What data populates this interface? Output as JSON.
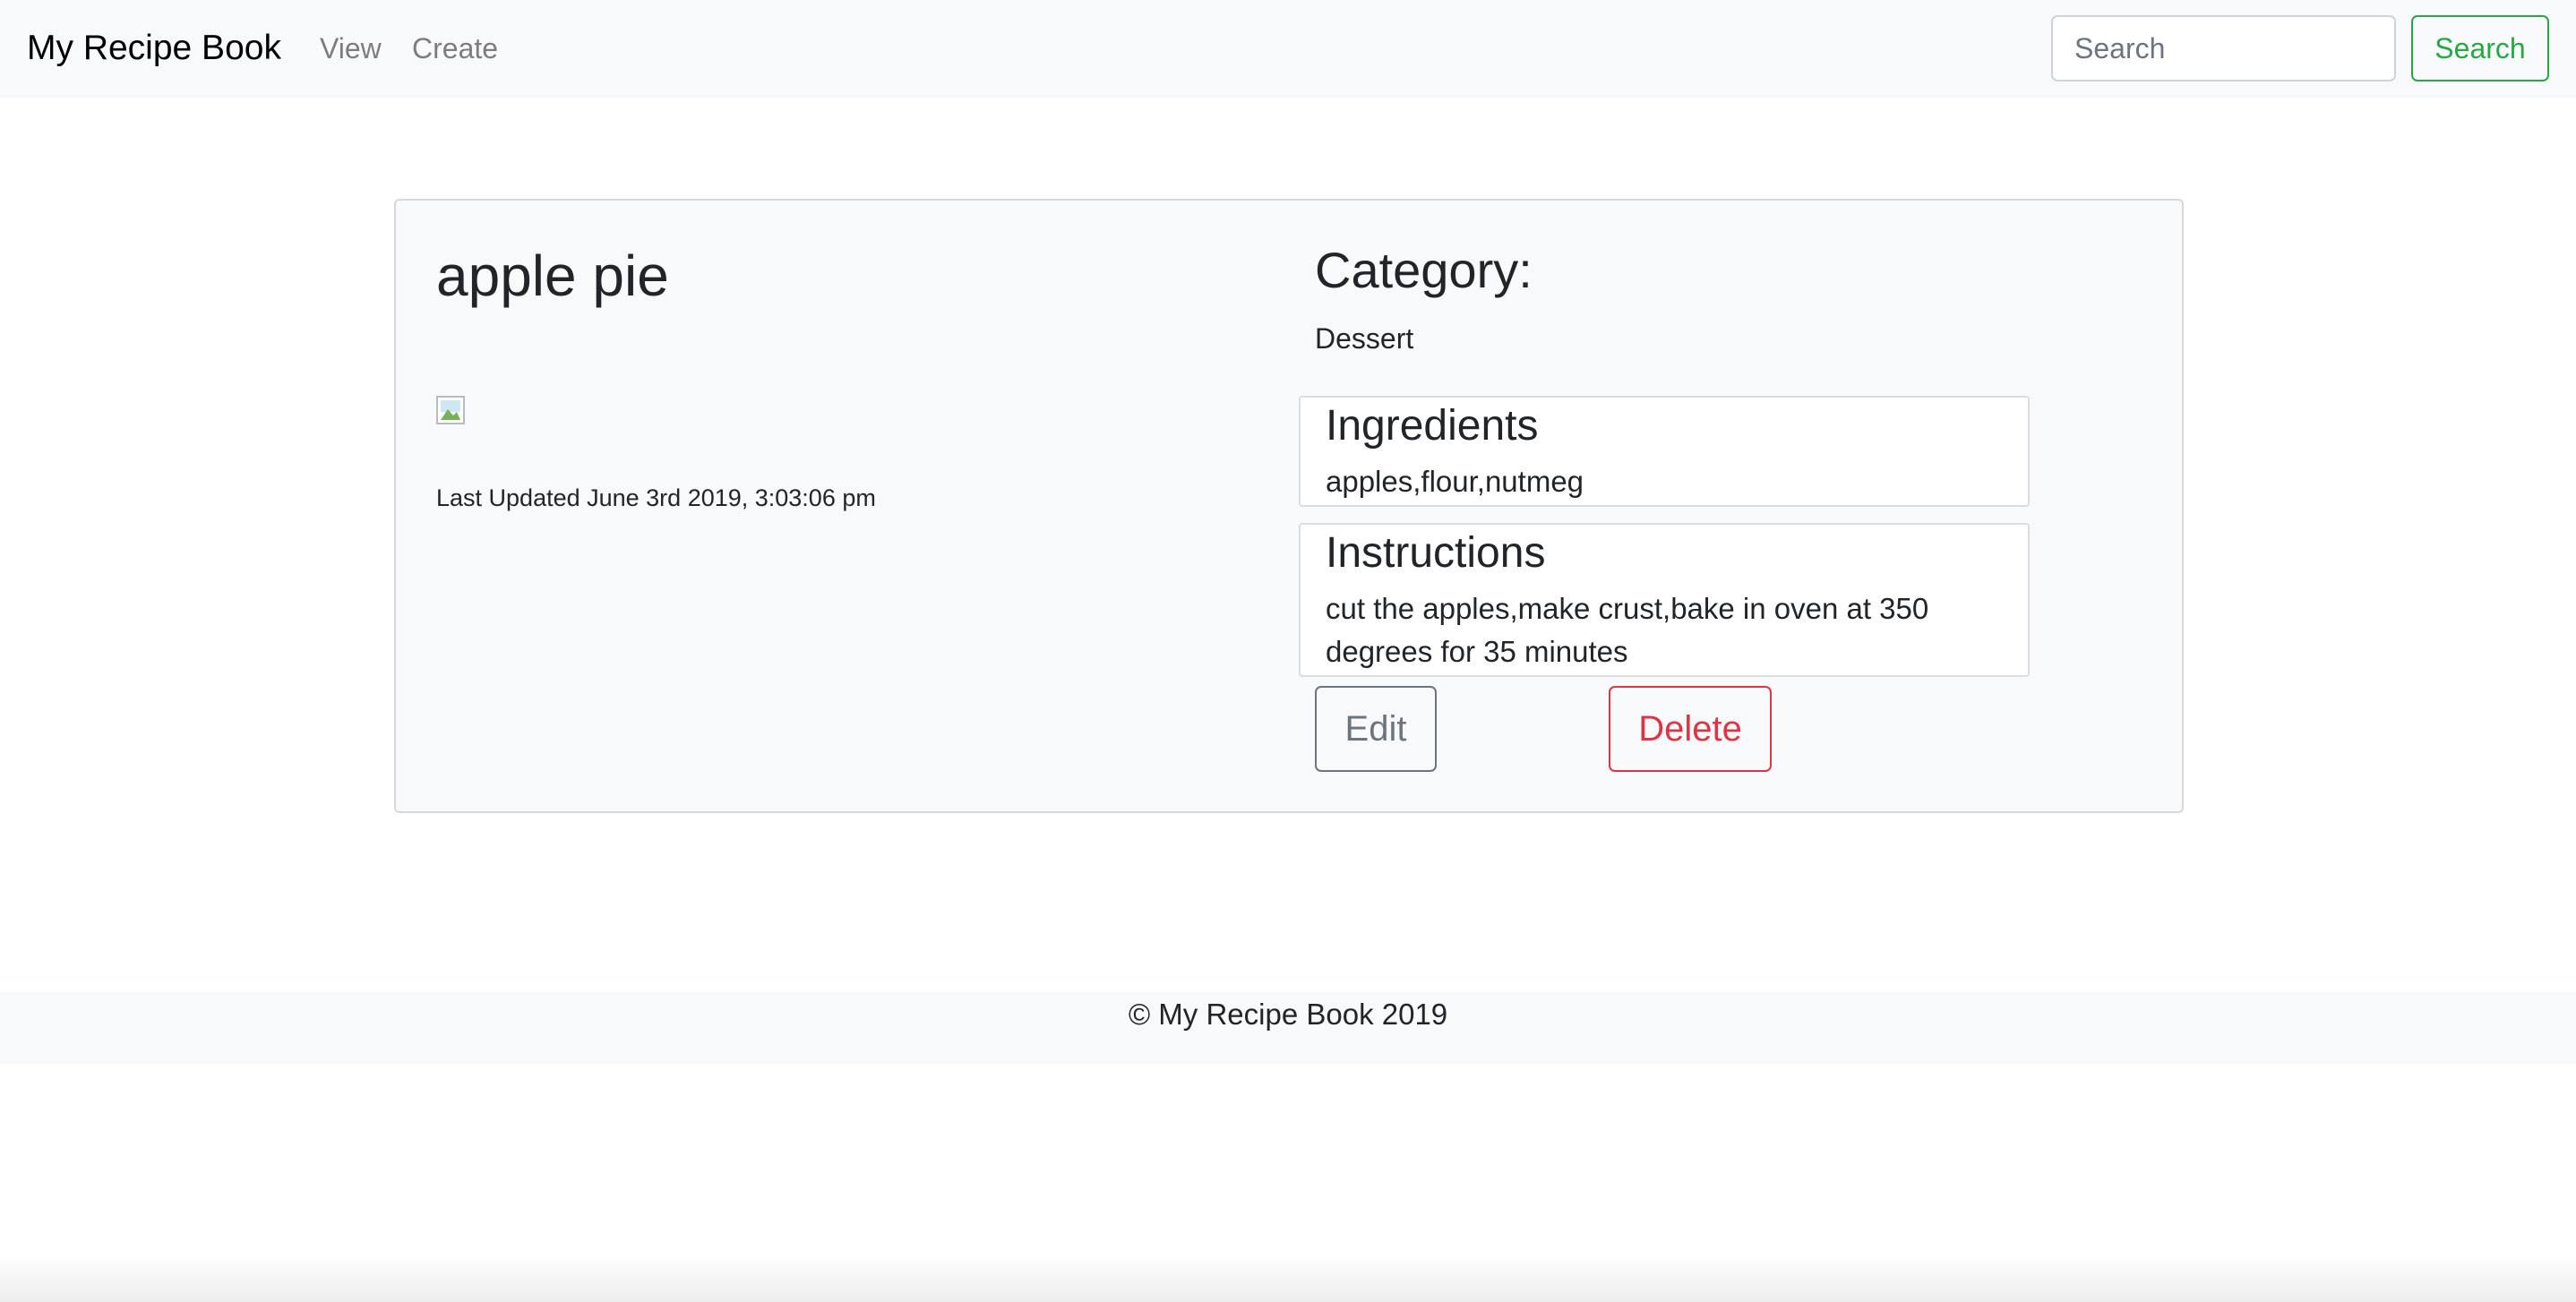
{
  "navbar": {
    "brand": "My Recipe Book",
    "links": [
      {
        "label": "View"
      },
      {
        "label": "Create"
      }
    ],
    "search": {
      "placeholder": "Search",
      "value": "",
      "button_label": "Search"
    }
  },
  "recipe": {
    "title": "apple pie",
    "image_alt": "",
    "last_updated": "Last Updated June 3rd 2019, 3:03:06 pm",
    "category_heading": "Category:",
    "category": "Dessert",
    "ingredients_heading": "Ingredients",
    "ingredients": "apples,flour,nutmeg",
    "instructions_heading": "Instructions",
    "instructions": "cut the apples,make crust,bake in oven at 350 degrees for 35 minutes",
    "edit_label": "Edit",
    "delete_label": "Delete"
  },
  "footer": {
    "text": "© My Recipe Book 2019"
  },
  "colors": {
    "navbar_bg": "#f8f9fa",
    "success": "#28a745",
    "secondary": "#6c757d",
    "danger": "#dc3545",
    "card_bg": "#f8f9fa"
  }
}
